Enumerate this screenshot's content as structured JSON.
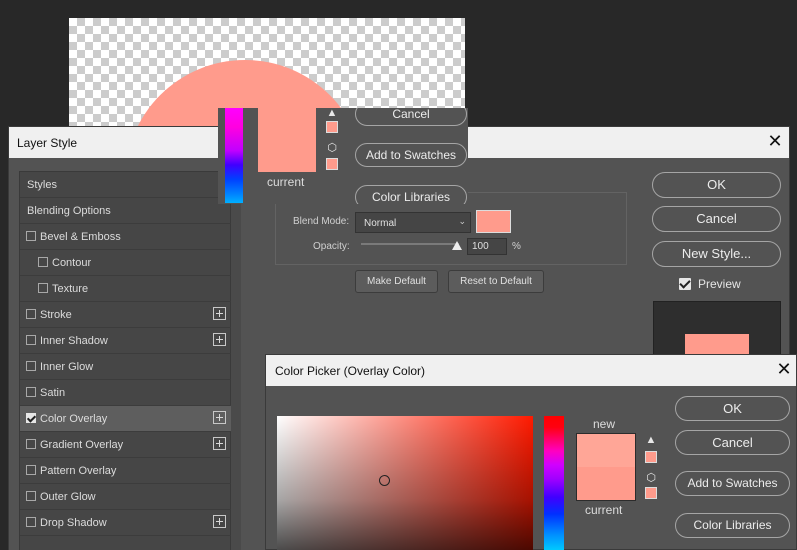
{
  "colors": {
    "overlay": "#ff9b8c",
    "canvas_shape": "#ff9b8c",
    "new_color": "#ffa697",
    "current_color": "#ff9b8c",
    "dialog_bg": "#535353",
    "titlebar_bg": "#f0f0f0"
  },
  "background_picker": {
    "current_label": "current",
    "buttons": {
      "cancel": "Cancel",
      "add_to_swatches": "Add to Swatches",
      "color_libraries": "Color Libraries"
    }
  },
  "layer_style": {
    "title": "Layer Style",
    "close": "✕",
    "styles": [
      {
        "label": "Styles",
        "checkbox": false,
        "plus": false,
        "checked": false
      },
      {
        "label": "Blending Options",
        "checkbox": false,
        "plus": false,
        "checked": false
      },
      {
        "label": "Bevel & Emboss",
        "checkbox": true,
        "plus": false,
        "checked": false
      },
      {
        "label": "Contour",
        "checkbox": true,
        "plus": false,
        "checked": false
      },
      {
        "label": "Texture",
        "checkbox": true,
        "plus": false,
        "checked": false
      },
      {
        "label": "Stroke",
        "checkbox": true,
        "plus": true,
        "checked": false
      },
      {
        "label": "Inner Shadow",
        "checkbox": true,
        "plus": true,
        "checked": false
      },
      {
        "label": "Inner Glow",
        "checkbox": true,
        "plus": false,
        "checked": false
      },
      {
        "label": "Satin",
        "checkbox": true,
        "plus": false,
        "checked": false
      },
      {
        "label": "Color Overlay",
        "checkbox": true,
        "plus": true,
        "checked": true
      },
      {
        "label": "Gradient Overlay",
        "checkbox": true,
        "plus": true,
        "checked": false
      },
      {
        "label": "Pattern Overlay",
        "checkbox": true,
        "plus": false,
        "checked": false
      },
      {
        "label": "Outer Glow",
        "checkbox": true,
        "plus": false,
        "checked": false
      },
      {
        "label": "Drop Shadow",
        "checkbox": true,
        "plus": true,
        "checked": false
      }
    ],
    "blend_mode_label": "Blend Mode:",
    "blend_mode_value": "Normal",
    "opacity_label": "Opacity:",
    "opacity_value": "100",
    "opacity_unit": "%",
    "opacity_level": 1.0,
    "make_default": "Make Default",
    "reset_to_default": "Reset to Default",
    "buttons": {
      "ok": "OK",
      "cancel": "Cancel",
      "new_style": "New Style..."
    },
    "preview_label": "Preview",
    "preview_checked": true
  },
  "color_picker": {
    "title": "Color Picker (Overlay Color)",
    "close": "✕",
    "new_label": "new",
    "current_label": "current",
    "buttons": {
      "ok": "OK",
      "cancel": "Cancel",
      "add_to_swatches": "Add to Swatches",
      "color_libraries": "Color Libraries"
    }
  }
}
